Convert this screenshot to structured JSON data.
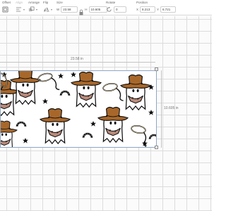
{
  "toolbar": {
    "offset_label": "Offset",
    "align_label": "Align",
    "arrange_label": "Arrange",
    "flip_label": "Flip",
    "size_label": "Size",
    "size_w_label": "W",
    "size_w_value": "23.58",
    "size_h_label": "H",
    "size_h_value": "10.605",
    "rotate_label": "Rotate",
    "rotate_value": "0",
    "position_label": "Position",
    "position_x_label": "X",
    "position_x_value": "8.213",
    "position_y_label": "Y",
    "position_y_value": "6.721"
  },
  "canvas": {
    "width_dimension": "23.58 in",
    "height_dimension": "10.605 in"
  },
  "colors": {
    "hat": "#a8672a",
    "bandana": "#b98a7a",
    "outline": "#111111"
  }
}
